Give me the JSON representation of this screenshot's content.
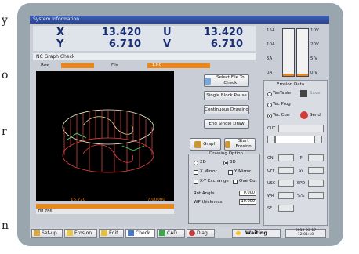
{
  "edge_text": [
    "y",
    "o",
    "r",
    "n"
  ],
  "window": {
    "title": "System Information"
  },
  "coords": [
    {
      "axis": "X",
      "value": "13.420"
    },
    {
      "axis": "Y",
      "value": "6.710"
    },
    {
      "axis": "U",
      "value": "13.420"
    },
    {
      "axis": "V",
      "value": "6.710"
    }
  ],
  "meters": {
    "left_labels": [
      "15A",
      "10A",
      "5A",
      "0A"
    ],
    "right_labels": [
      "10V",
      "20V",
      "5 V",
      "0 V"
    ],
    "current_level": 0.05,
    "voltage_level": 0.05
  },
  "graph": {
    "header": "NC Graph Check",
    "row_label_1": "Row",
    "row_label_2": "File",
    "file_name": "1.NC",
    "x_label_left": "16.720",
    "x_label_right": "7.00000",
    "status_line": "TM 786"
  },
  "buttons": {
    "select_file": "Select File To Check",
    "single_block_pause": "Single Block Pause",
    "continuous_drawing": "Continuous Drawing",
    "end_single_draw": "End Single Draw",
    "graph": "Graph",
    "start_erosion": "Start Erosion"
  },
  "drawing_option": {
    "title": "Drawing Option",
    "mode_2d": "2D",
    "mode_3d": "3D",
    "selected_mode": "3D",
    "x_mirror": "X Mirror",
    "y_mirror": "Y Mirror",
    "xy_exchange": "X-Y Exchange",
    "overcut": "OverCut",
    "rot_angle_label": "Rot Angle",
    "rot_angle_value": "0.000",
    "wp_thickness_label": "WP thickness",
    "wp_thickness_value": "10.000"
  },
  "erosion_data": {
    "title": "Erosion Data",
    "tec_table": "TecTable",
    "tec_prog": "Tec Prog",
    "tec_curr": "Tec Curr",
    "save": "Save",
    "send": "Send",
    "cut_label": "CUT",
    "fields_left": [
      "ON",
      "OFF",
      "USC",
      "WR",
      "SF"
    ],
    "fields_right": [
      "IP",
      "SV",
      "SPD",
      "%%"
    ]
  },
  "taskbar": {
    "setup": "Set-up",
    "erosion": "Erosion",
    "edit": "Edit",
    "check": "Check",
    "cad": "CAD",
    "diag": "Diag",
    "status": "Waiting",
    "date": "2013-03-17",
    "time": "12:01:10"
  }
}
